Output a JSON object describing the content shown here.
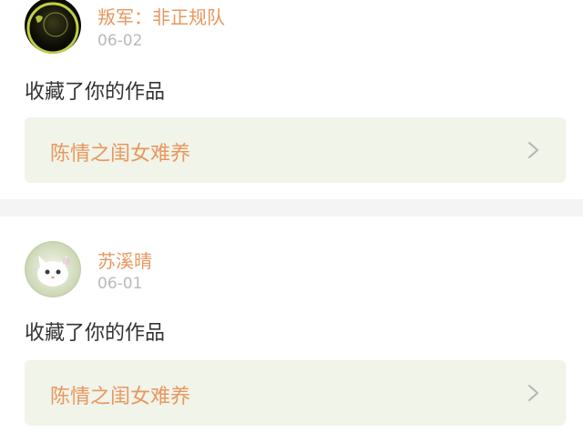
{
  "feed": {
    "items": [
      {
        "username": "叛军：非正规队",
        "date": "06-02",
        "action": "收藏了你的作品",
        "work_title": "陈情之闺女难养",
        "avatar": "dark-avatar-icon"
      },
      {
        "username": "苏溪晴",
        "date": "06-01",
        "action": "收藏了你的作品",
        "work_title": "陈情之闺女难养",
        "avatar": "white-cat-avatar-icon"
      }
    ]
  },
  "colors": {
    "accent": "#e8975f",
    "date": "#b9b9b9",
    "work_bg": "#f1f4e8",
    "separator": "#f4f4f4"
  }
}
